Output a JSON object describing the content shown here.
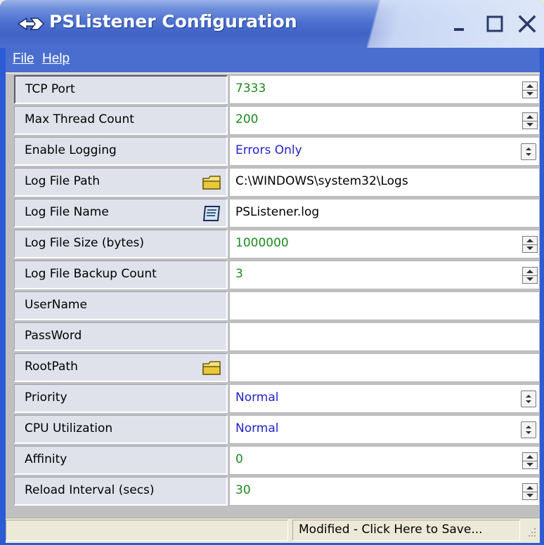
{
  "window": {
    "title": "PSListener Configuration",
    "accent": "#4a6ecf"
  },
  "menu": [
    {
      "label": "File",
      "mnemonic": "F"
    },
    {
      "label": "Help",
      "mnemonic": "H"
    }
  ],
  "rows": [
    {
      "label": "TCP Port",
      "value": "7333",
      "control": "spinner",
      "color": "green"
    },
    {
      "label": "Max Thread Count",
      "value": "200",
      "control": "spinner",
      "color": "green"
    },
    {
      "label": "Enable Logging",
      "value": "Errors Only",
      "control": "dropdown",
      "color": "blue"
    },
    {
      "label": "Log File Path",
      "value": "C:\\WINDOWS\\system32\\Logs",
      "control": "text",
      "color": "black",
      "icon": "folder-icon"
    },
    {
      "label": "Log File Name",
      "value": "PSListener.log",
      "control": "text",
      "color": "black",
      "icon": "notepad-icon"
    },
    {
      "label": "Log File Size (bytes)",
      "value": "1000000",
      "control": "spinner",
      "color": "green"
    },
    {
      "label": "Log File Backup Count",
      "value": "3",
      "control": "spinner",
      "color": "green"
    },
    {
      "label": "UserName",
      "value": "",
      "control": "text",
      "color": "black"
    },
    {
      "label": "PassWord",
      "value": "",
      "control": "text",
      "color": "black"
    },
    {
      "label": "RootPath",
      "value": "",
      "control": "text",
      "color": "black",
      "icon": "folder-icon"
    },
    {
      "label": "Priority",
      "value": "Normal",
      "control": "dropdown",
      "color": "blue"
    },
    {
      "label": "CPU Utilization",
      "value": "Normal",
      "control": "dropdown",
      "color": "blue"
    },
    {
      "label": "Affinity",
      "value": "0",
      "control": "spinner",
      "color": "green"
    },
    {
      "label": "Reload Interval (secs)",
      "value": "30",
      "control": "spinner",
      "color": "green"
    }
  ],
  "status": {
    "left": "",
    "message": "Modified - Click Here to Save..."
  }
}
